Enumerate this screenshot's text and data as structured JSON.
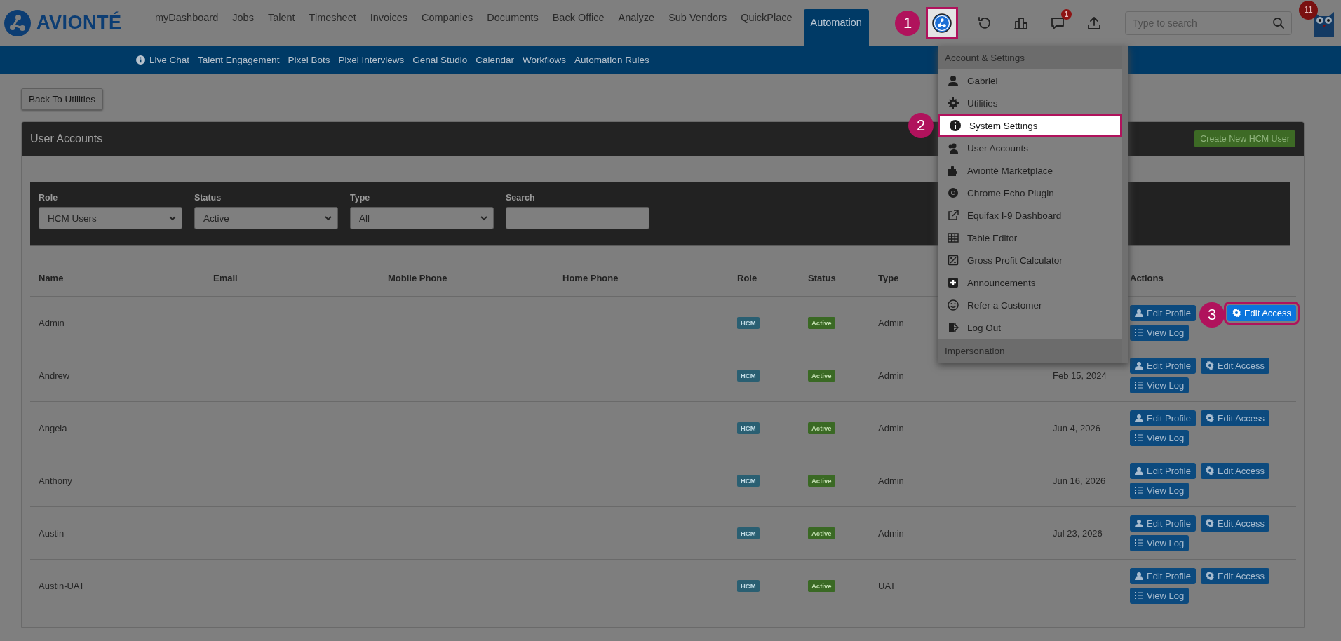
{
  "brand": {
    "name": "AVIONTÉ"
  },
  "nav": [
    {
      "label": "myDashboard",
      "selected": false
    },
    {
      "label": "Jobs",
      "selected": false
    },
    {
      "label": "Talent",
      "selected": false
    },
    {
      "label": "Timesheet",
      "selected": false
    },
    {
      "label": "Invoices",
      "selected": false
    },
    {
      "label": "Companies",
      "selected": false
    },
    {
      "label": "Documents",
      "selected": false
    },
    {
      "label": "Back Office",
      "selected": false
    },
    {
      "label": "Analyze",
      "selected": false
    },
    {
      "label": "Sub Vendors",
      "selected": false
    },
    {
      "label": "QuickPlace",
      "selected": false
    },
    {
      "label": "Automation",
      "selected": true
    }
  ],
  "subnav": [
    {
      "label": "Live Chat"
    },
    {
      "label": "Talent Engagement"
    },
    {
      "label": "Pixel Bots"
    },
    {
      "label": "Pixel Interviews"
    },
    {
      "label": "Genai Studio"
    },
    {
      "label": "Calendar"
    },
    {
      "label": "Workflows"
    },
    {
      "label": "Automation Rules"
    }
  ],
  "toolbar": {
    "chat_badge": "1",
    "search": {
      "placeholder": "Type to search"
    },
    "avatar_badge": "11"
  },
  "callouts": [
    "1",
    "2",
    "3"
  ],
  "menu": {
    "header": "Account & Settings",
    "items": [
      {
        "label": "Gabriel",
        "selected": false
      },
      {
        "label": "Utilities",
        "selected": false
      },
      {
        "label": "System Settings",
        "selected": true
      },
      {
        "label": "User Accounts",
        "selected": false
      },
      {
        "label": "Avionté Marketplace",
        "selected": false
      },
      {
        "label": "Chrome Echo Plugin",
        "selected": false
      },
      {
        "label": "Equifax I-9 Dashboard",
        "selected": false
      },
      {
        "label": "Table Editor",
        "selected": false
      },
      {
        "label": "Gross Profit Calculator",
        "selected": false
      },
      {
        "label": "Announcements",
        "selected": false
      },
      {
        "label": "Refer a Customer",
        "selected": false
      },
      {
        "label": "Log Out",
        "selected": false
      }
    ],
    "section": "Impersonation"
  },
  "back_button": "Back To Utilities",
  "card": {
    "title": "User Accounts",
    "create_button": "Create New HCM User"
  },
  "filters": [
    {
      "label": "Role",
      "kind": "select",
      "value": "HCM Users"
    },
    {
      "label": "Status",
      "kind": "select",
      "value": "Active"
    },
    {
      "label": "Type",
      "kind": "select",
      "value": "All"
    },
    {
      "label": "Search",
      "kind": "text"
    }
  ],
  "table": {
    "columns": [
      "Name",
      "Email",
      "Mobile Phone",
      "Home Phone",
      "Role",
      "Status",
      "Type",
      "Actions"
    ],
    "rows": [
      {
        "name": "Admin",
        "role": "HCM",
        "status": "Active",
        "type": "Admin",
        "actions": [
          "Edit Profile",
          "Edit Access",
          "View Log"
        ],
        "highlighted": true
      },
      {
        "name": "Andrew",
        "role": "HCM",
        "status": "Active",
        "type": "Admin",
        "date": "Feb 15, 2024",
        "actions": [
          "Edit Profile",
          "Edit Access",
          "View Log"
        ],
        "highlighted": false
      },
      {
        "name": "Angela",
        "role": "HCM",
        "status": "Active",
        "type": "Admin",
        "date": "Jun 4, 2026",
        "actions": [
          "Edit Profile",
          "Edit Access",
          "View Log"
        ],
        "highlighted": false
      },
      {
        "name": "Anthony",
        "role": "HCM",
        "status": "Active",
        "type": "Admin",
        "date": "Jun 16, 2026",
        "actions": [
          "Edit Profile",
          "Edit Access",
          "View Log"
        ],
        "highlighted": false
      },
      {
        "name": "Austin",
        "role": "HCM",
        "status": "Active",
        "type": "Admin",
        "date": "Jul 23, 2026",
        "actions": [
          "Edit Profile",
          "Edit Access",
          "View Log"
        ],
        "highlighted": false
      },
      {
        "name": "Austin-UAT",
        "role": "HCM",
        "status": "Active",
        "type": "UAT",
        "actions": [
          "Edit Profile",
          "Edit Access",
          "View Log"
        ],
        "highlighted": false
      }
    ]
  }
}
